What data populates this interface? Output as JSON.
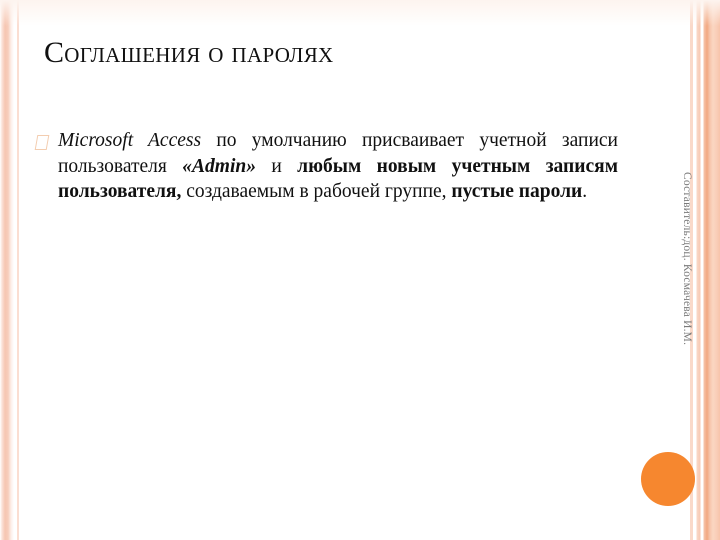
{
  "slide": {
    "title": "Соглашения о паролях",
    "author_credit": "Составитель:доц. Космачева И.М.",
    "bullet_marker_icon": "hollow-parallelogram-bullet-icon",
    "accent_circle_icon": "orange-circle-decoration-icon",
    "colors": {
      "accent_orange": "#f6872f",
      "border_peach": "#f2a881",
      "border_light_peach": "#fad9c9",
      "bullet_outline": "#f3cdb0",
      "text": "#101010",
      "author_text": "#7a7a7a",
      "background": "#ffffff"
    }
  },
  "body": {
    "bullet": {
      "seg1_italic": "Microsoft Access",
      "seg2_plain": " по умолчанию присваивает учетной записи пользователя ",
      "seg3_bold_italic": "«Admin»",
      "seg4_plain": " и ",
      "seg5_bold": "любым новым учетным записям пользователя,",
      "seg6_plain": " создаваемым в рабочей группе, ",
      "seg7_bold": "пустые пароли",
      "seg8_plain": "."
    }
  }
}
